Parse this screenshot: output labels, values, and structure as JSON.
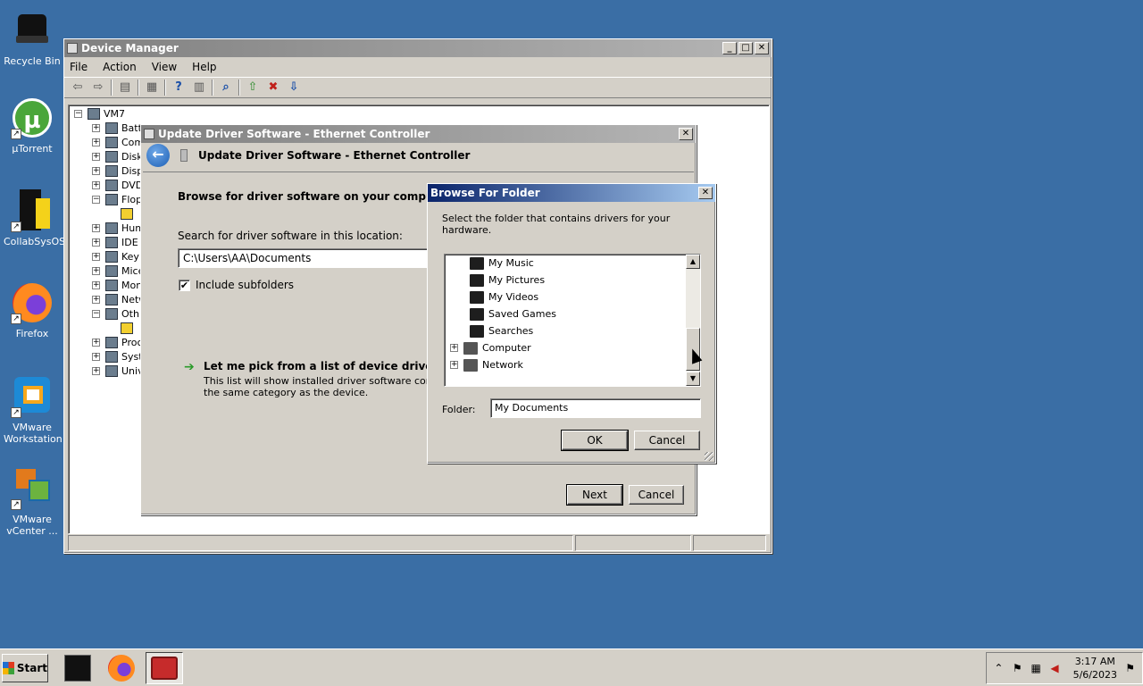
{
  "desktop": {
    "icons": [
      {
        "label": "Recycle Bin"
      },
      {
        "label": "µTorrent"
      },
      {
        "label": "CollabSysOS"
      },
      {
        "label": "Firefox"
      },
      {
        "label": "VMware Workstation"
      },
      {
        "label": "VMware vCenter ..."
      }
    ]
  },
  "device_manager": {
    "title": "Device Manager",
    "menu": [
      "File",
      "Action",
      "View",
      "Help"
    ],
    "tree": {
      "root": "VM7",
      "items": [
        "Batt",
        "Com",
        "Disk",
        "Disp",
        "DVD",
        "Flop",
        "",
        "Hum",
        "IDE",
        "Key",
        "Mice",
        "Mon",
        "Netw",
        "Oth",
        "",
        "Proc",
        "Syst",
        "Univ"
      ]
    }
  },
  "update_driver": {
    "title": "Update Driver Software - Ethernet Controller",
    "header": "Update Driver Software - Ethernet Controller",
    "heading": "Browse for driver software on your computer",
    "search_label": "Search for driver software in this location:",
    "path_value": "C:\\Users\\AA\\Documents",
    "include_subfolders": "Include subfolders",
    "pick_title": "Let me pick from a list of device drivers on m",
    "pick_desc_1": "This list will show installed driver software compatible",
    "pick_desc_2": "the same category as the device.",
    "next": "Next",
    "cancel": "Cancel"
  },
  "browse_folder": {
    "title": "Browse For Folder",
    "instruction": "Select the folder that contains drivers for your hardware.",
    "items": [
      "My Music",
      "My Pictures",
      "My Videos",
      "Saved Games",
      "Searches",
      "Computer",
      "Network"
    ],
    "folder_label": "Folder:",
    "folder_value": "My Documents",
    "ok": "OK",
    "cancel": "Cancel"
  },
  "taskbar": {
    "start": "Start",
    "time": "3:17 AM",
    "date": "5/6/2023"
  }
}
